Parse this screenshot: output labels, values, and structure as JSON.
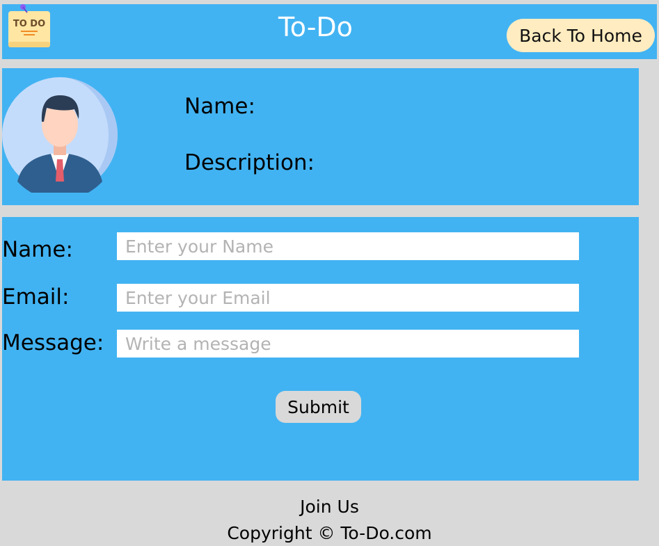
{
  "header": {
    "logo_text": "TO DO",
    "title": "To-Do",
    "back_button": "Back To Home"
  },
  "profile": {
    "name_label": "Name:",
    "description_label": "Description:"
  },
  "form": {
    "name_label": "Name:",
    "name_placeholder": "Enter your Name",
    "email_label": "Email:",
    "email_placeholder": "Enter your Email",
    "message_label": "Message:",
    "message_placeholder": "Write a message",
    "submit_label": "Submit"
  },
  "footer": {
    "join": "Join Us",
    "copyright": "Copyright © To-Do.com"
  },
  "colors": {
    "panel_blue": "#42b3f2",
    "background_gray": "#d9d9d9",
    "back_button_bg": "#ffecc0"
  }
}
